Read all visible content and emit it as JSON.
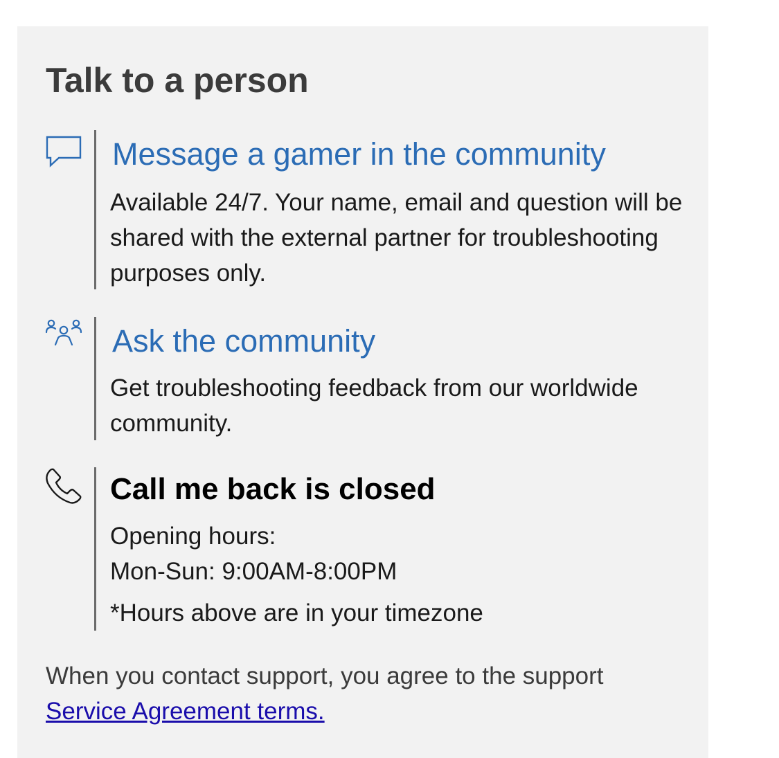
{
  "panel": {
    "title": "Talk to a person"
  },
  "options": {
    "message": {
      "icon": "chat-bubble-icon",
      "link": "Message a gamer in the community",
      "description": "Available 24/7. Your name, email and question will be shared with the external partner for troubleshooting purposes only."
    },
    "community": {
      "icon": "people-group-icon",
      "link": "Ask the community",
      "description": "Get troubleshooting feedback from our worldwide community."
    },
    "callback": {
      "icon": "phone-icon",
      "heading": "Call me back is closed",
      "hours_label": "Opening hours:",
      "hours_value": "Mon-Sun: 9:00AM-8:00PM",
      "timezone_note": "*Hours above are in your timezone"
    }
  },
  "footer": {
    "text": "When you contact support, you agree to the support",
    "link": "Service Agreement terms."
  },
  "colors": {
    "panel_background": "#f2f2f2",
    "link_blue": "#2b6cb5",
    "footer_link": "#1a0dab",
    "divider": "#6b6b6b"
  }
}
